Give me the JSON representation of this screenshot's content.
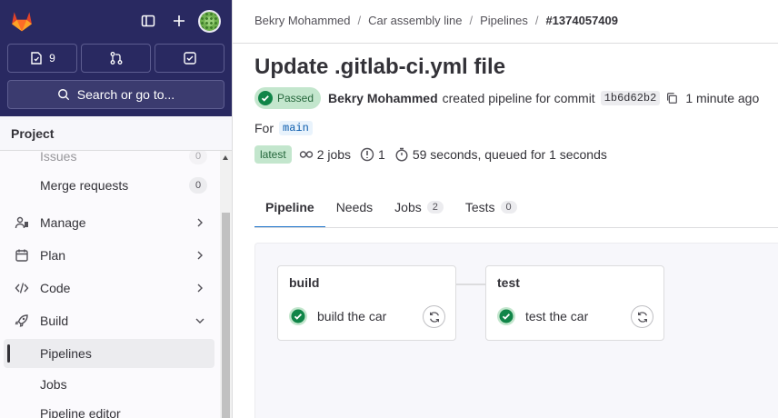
{
  "colors": {
    "sidebar_top": "#292961",
    "success": "#108548",
    "success_bg": "#c3e6cd",
    "link_blue": "#1f75cb"
  },
  "sidebar": {
    "counters": [
      {
        "icon": "issues-icon",
        "count": "9"
      },
      {
        "icon": "merge-request-icon",
        "count": ""
      },
      {
        "icon": "todo-icon",
        "count": ""
      }
    ],
    "search_label": "Search or go to...",
    "section_title": "Project",
    "items": [
      {
        "label": "Issues",
        "badge": "0"
      },
      {
        "label": "Merge requests",
        "badge": "0"
      },
      {
        "label": "Manage",
        "icon": "manage-icon"
      },
      {
        "label": "Plan",
        "icon": "plan-icon"
      },
      {
        "label": "Code",
        "icon": "code-icon"
      },
      {
        "label": "Build",
        "icon": "rocket-icon"
      },
      {
        "label": "Pipelines"
      },
      {
        "label": "Jobs"
      },
      {
        "label": "Pipeline editor"
      }
    ]
  },
  "breadcrumb": [
    "Bekry Mohammed",
    "Car assembly line",
    "Pipelines",
    "#1374057409"
  ],
  "pipeline": {
    "title": "Update .gitlab-ci.yml file",
    "status": "Passed",
    "author": "Bekry Mohammed",
    "action_text": "created pipeline for commit",
    "commit_sha": "1b6d62b2",
    "time_ago": "1 minute ago",
    "for_label": "For",
    "branch": "main",
    "latest_label": "latest",
    "jobs_count": "2 jobs",
    "stages_count": "1",
    "duration": "59 seconds, queued for 1 seconds"
  },
  "tabs": [
    {
      "label": "Pipeline",
      "count": ""
    },
    {
      "label": "Needs",
      "count": ""
    },
    {
      "label": "Jobs",
      "count": "2"
    },
    {
      "label": "Tests",
      "count": "0"
    }
  ],
  "stages": [
    {
      "name": "build",
      "job": "build the car",
      "status": "success"
    },
    {
      "name": "test",
      "job": "test the car",
      "status": "success"
    }
  ]
}
